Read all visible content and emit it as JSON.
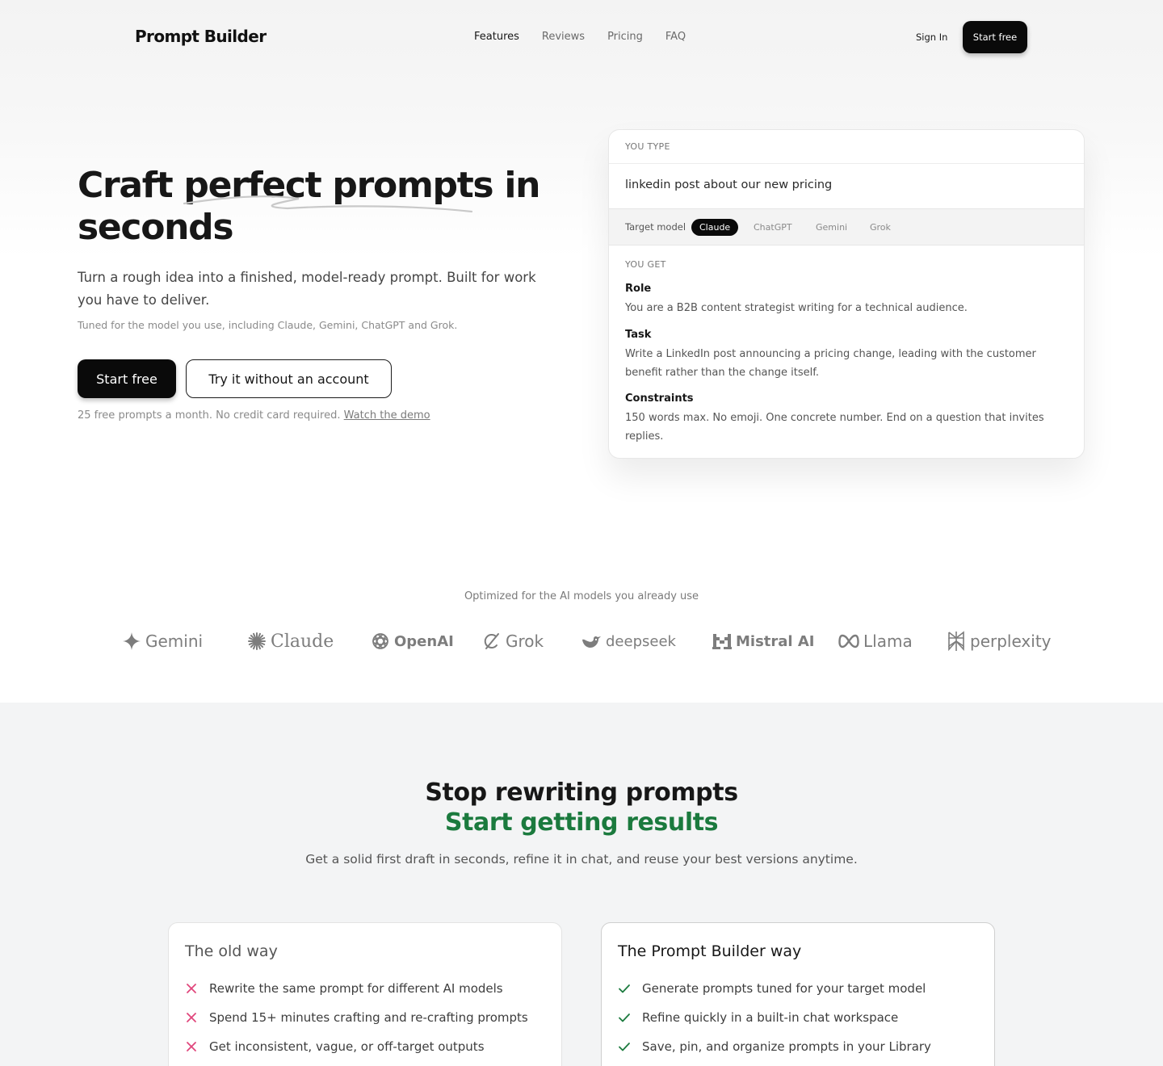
{
  "header": {
    "logo": "Prompt Builder",
    "nav": [
      "Features",
      "Reviews",
      "Pricing",
      "FAQ"
    ],
    "sign_in": "Sign In",
    "start_free": "Start free"
  },
  "hero": {
    "title_line1": "Craft perfect prompts in",
    "title_line2": "seconds",
    "subtitle": "Turn a rough idea into a finished, model-ready prompt. Built for work you have to deliver.",
    "tuned": "Tuned for the model you use, including Claude, Gemini, ChatGPT and Grok.",
    "primary_button": "Start free",
    "secondary_button": "Try it without an account",
    "note": "25 free prompts a month. No credit card required.",
    "demo_link": "Watch the demo"
  },
  "demo_card": {
    "you_type_label": "YOU TYPE",
    "input_text": "linkedin post about our new pricing",
    "target_model_label": "Target model",
    "models": [
      "Claude",
      "ChatGPT",
      "Gemini",
      "Grok"
    ],
    "selected_model": "Claude",
    "you_get_label": "YOU GET",
    "sections": [
      {
        "heading": "Role",
        "text": "You are a B2B content strategist writing for a technical audience."
      },
      {
        "heading": "Task",
        "text": "Write a LinkedIn post announcing a pricing change, leading with the customer benefit rather than the change itself."
      },
      {
        "heading": "Constraints",
        "text": "150 words max. No emoji. One concrete number. End on a question that invites replies."
      }
    ]
  },
  "models_row": {
    "caption": "Optimized for the AI models you already use",
    "brands": [
      {
        "name": "Gemini",
        "icon": "gemini-star-icon"
      },
      {
        "name": "Claude",
        "icon": "claude-burst-icon"
      },
      {
        "name": "OpenAI",
        "icon": "openai-knot-icon"
      },
      {
        "name": "Grok",
        "icon": "grok-slash-icon"
      },
      {
        "name": "deepseek",
        "icon": "deepseek-whale-icon"
      },
      {
        "name": "Mistral AI",
        "icon": "mistral-blocks-icon"
      },
      {
        "name": "Llama",
        "icon": "meta-infinity-icon"
      },
      {
        "name": "perplexity",
        "icon": "perplexity-icon"
      }
    ]
  },
  "comparison": {
    "title": "Stop rewriting prompts",
    "title_accent": "Start getting results",
    "subtitle": "Get a solid first draft in seconds, refine it in chat, and reuse your best versions anytime.",
    "accent_color": "#1b7a3e",
    "old_way": {
      "title": "The old way",
      "icon": "x-icon",
      "icon_color": "#e0467c",
      "items": [
        "Rewrite the same prompt for different AI models",
        "Spend 15+ minutes crafting and re-crafting prompts",
        "Get inconsistent, vague, or off-target outputs"
      ]
    },
    "new_way": {
      "title": "The Prompt Builder way",
      "icon": "check-icon",
      "icon_color": "#1b7a3e",
      "items": [
        "Generate prompts tuned for your target model",
        "Refine quickly in a built-in chat workspace",
        "Save, pin, and organize prompts in your Library"
      ]
    }
  }
}
